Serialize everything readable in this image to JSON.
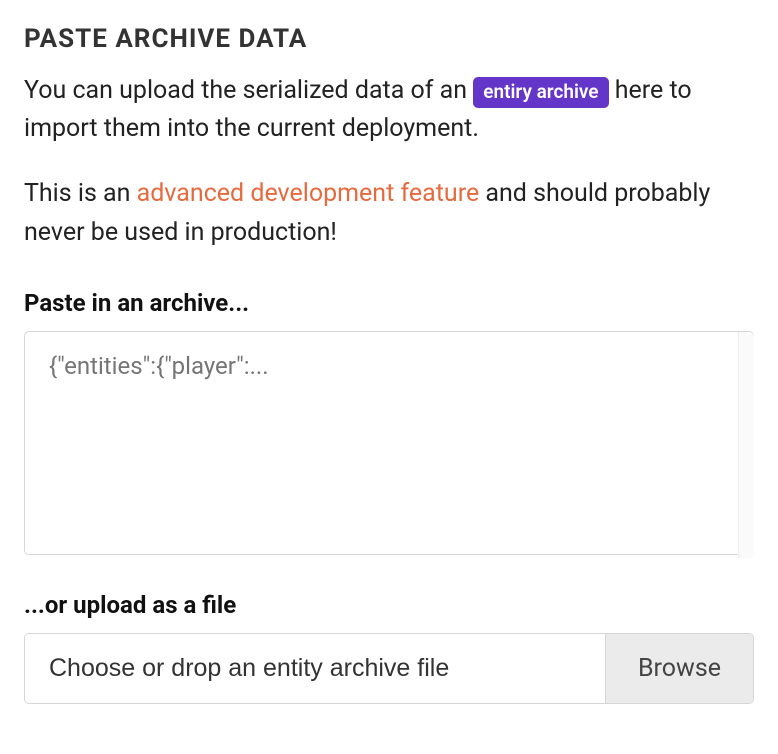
{
  "heading": "PASTE ARCHIVE DATA",
  "description": {
    "prefix": "You can upload the serialized data of an ",
    "tag": "entiry archive",
    "suffix": " here to import them into the current deployment."
  },
  "warning": {
    "prefix": "This is an ",
    "link": "advanced development feature",
    "suffix": " and should probably never be used in production!"
  },
  "paste_section": {
    "label": "Paste in an archive...",
    "placeholder": "{\"entities\":{\"player\":..."
  },
  "upload_section": {
    "label": "...or upload as a file",
    "placeholder": "Choose or drop an entity archive file",
    "button": "Browse"
  }
}
